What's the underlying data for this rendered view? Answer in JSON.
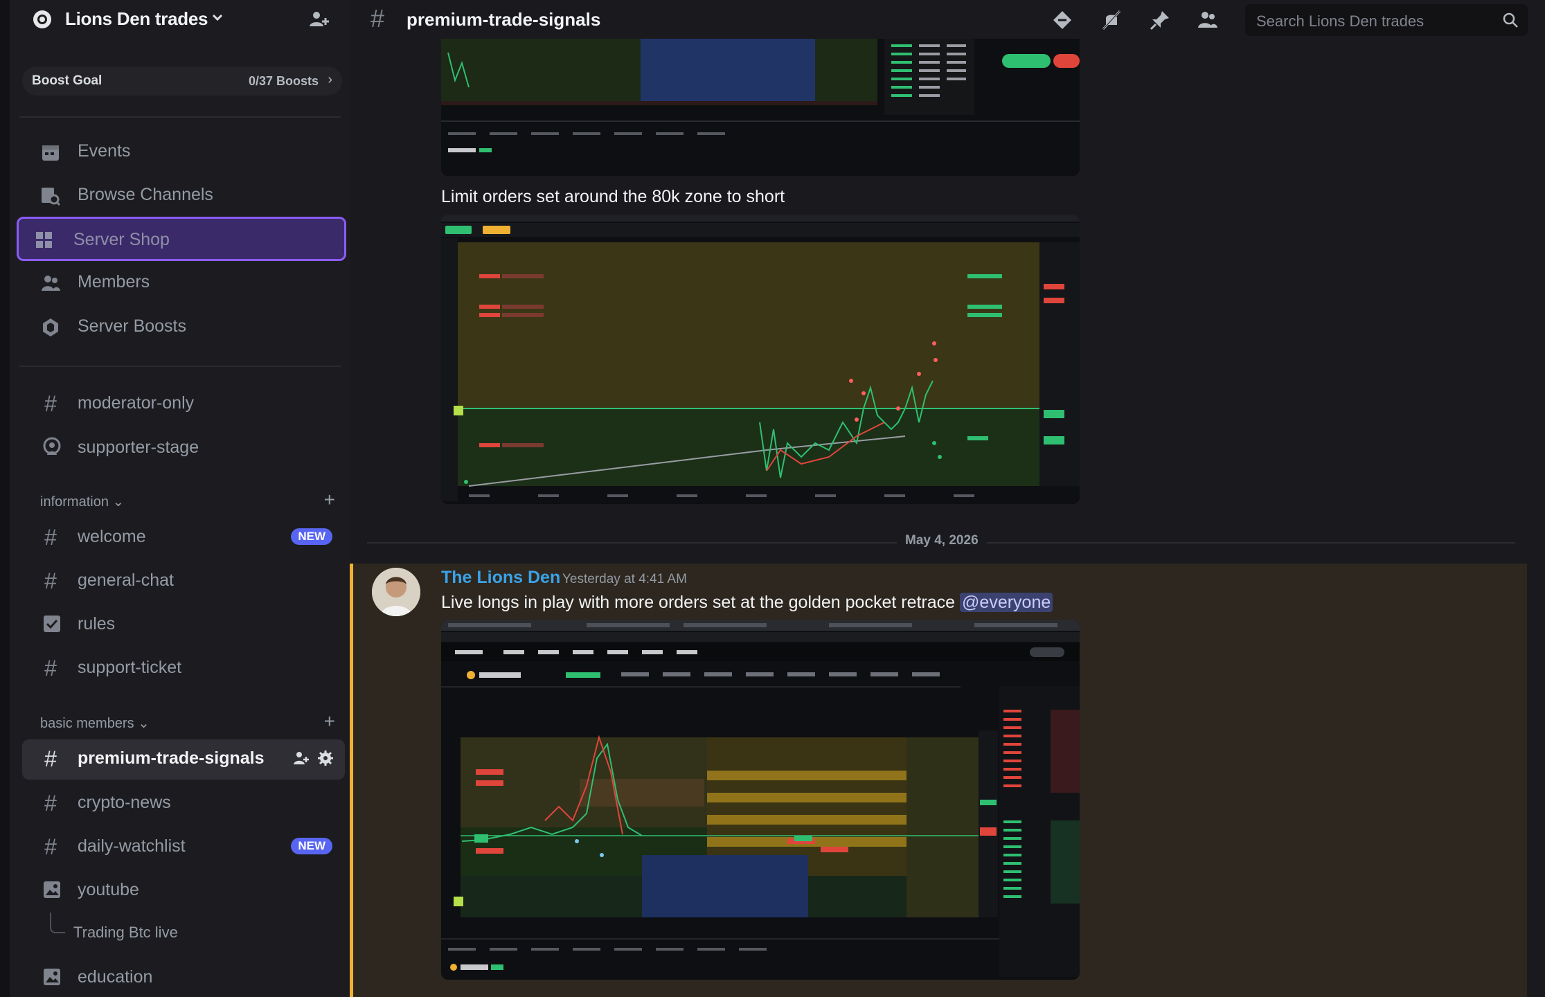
{
  "server": {
    "name": "Lions Den trades",
    "boost_label": "Boost Goal",
    "boost_count": "0/37 Boosts"
  },
  "nav": [
    {
      "label": "Events",
      "icon": "calendar-icon"
    },
    {
      "label": "Browse Channels",
      "icon": "browse-channels-icon"
    },
    {
      "label": "Server Shop",
      "icon": "shop-icon"
    },
    {
      "label": "Members",
      "icon": "members-icon"
    },
    {
      "label": "Server Boosts",
      "icon": "boost-icon"
    }
  ],
  "channels_top": [
    {
      "label": "moderator-only"
    },
    {
      "label": "supporter-stage"
    }
  ],
  "categories": {
    "information": "information",
    "basic_members": "basic members"
  },
  "info_channels": [
    {
      "label": "welcome",
      "badge": "NEW"
    },
    {
      "label": "general-chat"
    },
    {
      "label": "rules"
    },
    {
      "label": "support-ticket"
    }
  ],
  "member_channels": [
    {
      "label": "premium-trade-signals"
    },
    {
      "label": "crypto-news"
    },
    {
      "label": "daily-watchlist",
      "badge": "NEW"
    },
    {
      "label": "youtube"
    },
    {
      "label": "Trading Btc live"
    },
    {
      "label": "education"
    }
  ],
  "topbar": {
    "channel": "premium-trade-signals",
    "search_placeholder": "Search Lions Den trades"
  },
  "messages": {
    "caption1": "Limit orders set around the 80k zone to short",
    "date_divider": "May 4, 2026",
    "author": "The Lions Den",
    "timestamp": "Yesterday at 4:41 AM",
    "text": "Live longs in play with more orders set at the golden pocket retrace",
    "mention": "@everyone"
  },
  "colors": {
    "accent": "#5865f2",
    "highlight_bar": "#f0b132",
    "author": "#3aa3e8",
    "shop_border": "#8a5cf6"
  }
}
